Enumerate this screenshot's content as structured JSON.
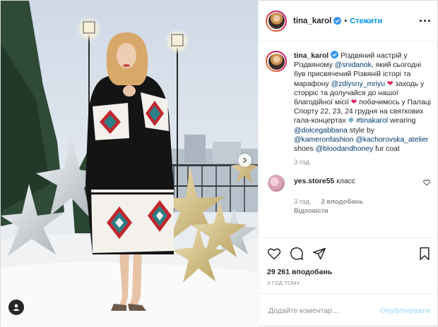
{
  "header": {
    "username": "tina_karol",
    "follow_label": "Стежити",
    "separator": "•"
  },
  "caption": {
    "username": "tina_karol",
    "text_1": "Різдвяний настрій у Різдвяному ",
    "mention_1": "@snidanok",
    "text_2": ", який сьогодні був присвячений Різвяній історі та марафону ",
    "mention_2": "@zdiysny_mriyu",
    "heart_1": "❤",
    "text_3": " заходь у сторріс та долучайся до нашої благодійної місії ",
    "heart_2": "❤",
    "text_4": " побачимось у Палаці Спорту 22, 23, 24 грудня на святкових гала-концертах ",
    "snow": "❄",
    "tag_1": "#tinakarol",
    "text_5": " wearing ",
    "mention_3": "@dolcegabbana",
    "text_6": " style by ",
    "mention_4": "@kameronfashion",
    "mention_5": "@kachorovska_atelier",
    "text_7": " shoes ",
    "mention_6": "@bloodandhoney",
    "text_8": " fur coat",
    "time": "3 год."
  },
  "comment": {
    "username": "yes.store55",
    "text": "класс",
    "time": "3 год.",
    "likes": "2 вподобань",
    "reply_label": "Відповісти"
  },
  "stats": {
    "likes": "29 261 вподобань",
    "time": "3 ГОД ТОМУ"
  },
  "add_comment": {
    "placeholder": "Додайте коментар...",
    "publish_label": "Опублікувати"
  },
  "colors": {
    "accent": "#0095f6",
    "publish_disabled": "#b2dffc",
    "muted": "#8e8e8e",
    "mention": "#00376b",
    "heart": "#e0245e"
  }
}
